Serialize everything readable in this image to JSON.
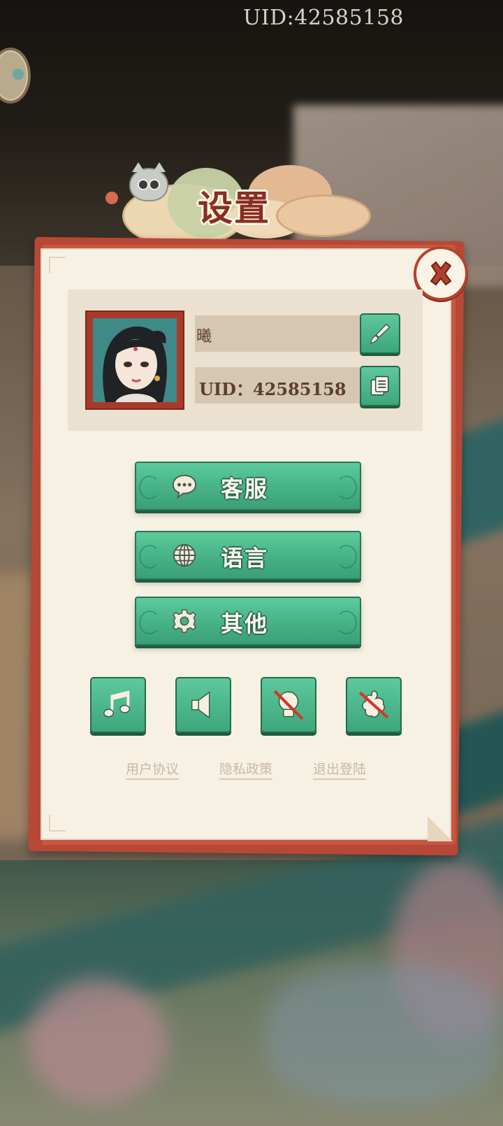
{
  "top_uid": "UID:42585158",
  "dialog": {
    "title": "设置",
    "profile": {
      "name": "曦",
      "uid": "UID：42585158"
    },
    "buttons": [
      {
        "label": "客服",
        "icon": "chat-bubble-icon"
      },
      {
        "label": "语言",
        "icon": "globe-icon"
      },
      {
        "label": "其他",
        "icon": "gear-icon"
      }
    ],
    "toggles": [
      {
        "icon": "music-note-icon",
        "state": "on"
      },
      {
        "icon": "speaker-icon",
        "state": "on"
      },
      {
        "icon": "lightbulb-icon",
        "state": "off"
      },
      {
        "icon": "effects-icon",
        "state": "off"
      }
    ],
    "links": {
      "user_agreement": "用户协议",
      "privacy_policy": "隐私政策",
      "logout": "退出登陆"
    }
  },
  "colors": {
    "accent_green": "#46b285",
    "frame_red": "#b84836",
    "paper": "#f7f1e4",
    "title_red": "#8a2d22"
  }
}
